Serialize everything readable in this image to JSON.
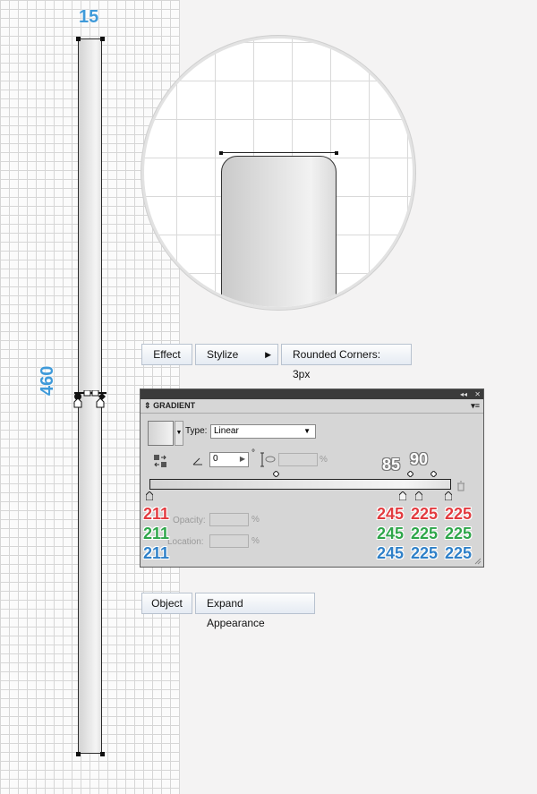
{
  "dimensions": {
    "width_label": "15",
    "height_label": "460"
  },
  "menu1": {
    "items": [
      {
        "label": "Effect"
      },
      {
        "label": "Stylize"
      },
      {
        "label": "Rounded Corners: 3px"
      }
    ]
  },
  "menu2": {
    "items": [
      {
        "label": "Object"
      },
      {
        "label": "Expand Appearance"
      }
    ]
  },
  "gradient_panel": {
    "title": "GRADIENT",
    "type_label": "Type:",
    "type_value": "Linear",
    "angle_value": "0",
    "degree_symbol": "°",
    "percent_symbol": "%",
    "opacity_label": "Opacity:",
    "location_label": "Location:",
    "location_labels": [
      "85",
      "90"
    ],
    "left_color": {
      "r": "211",
      "g": "211",
      "b": "211"
    },
    "stops": [
      {
        "r": "245",
        "g": "245",
        "b": "245"
      },
      {
        "r": "225",
        "g": "225",
        "b": "225"
      },
      {
        "r": "225",
        "g": "225",
        "b": "225"
      }
    ]
  },
  "colors": {
    "r": "#e23b40",
    "g": "#2ea64a",
    "b": "#2f80c8",
    "dim": "#3f9ad9"
  }
}
